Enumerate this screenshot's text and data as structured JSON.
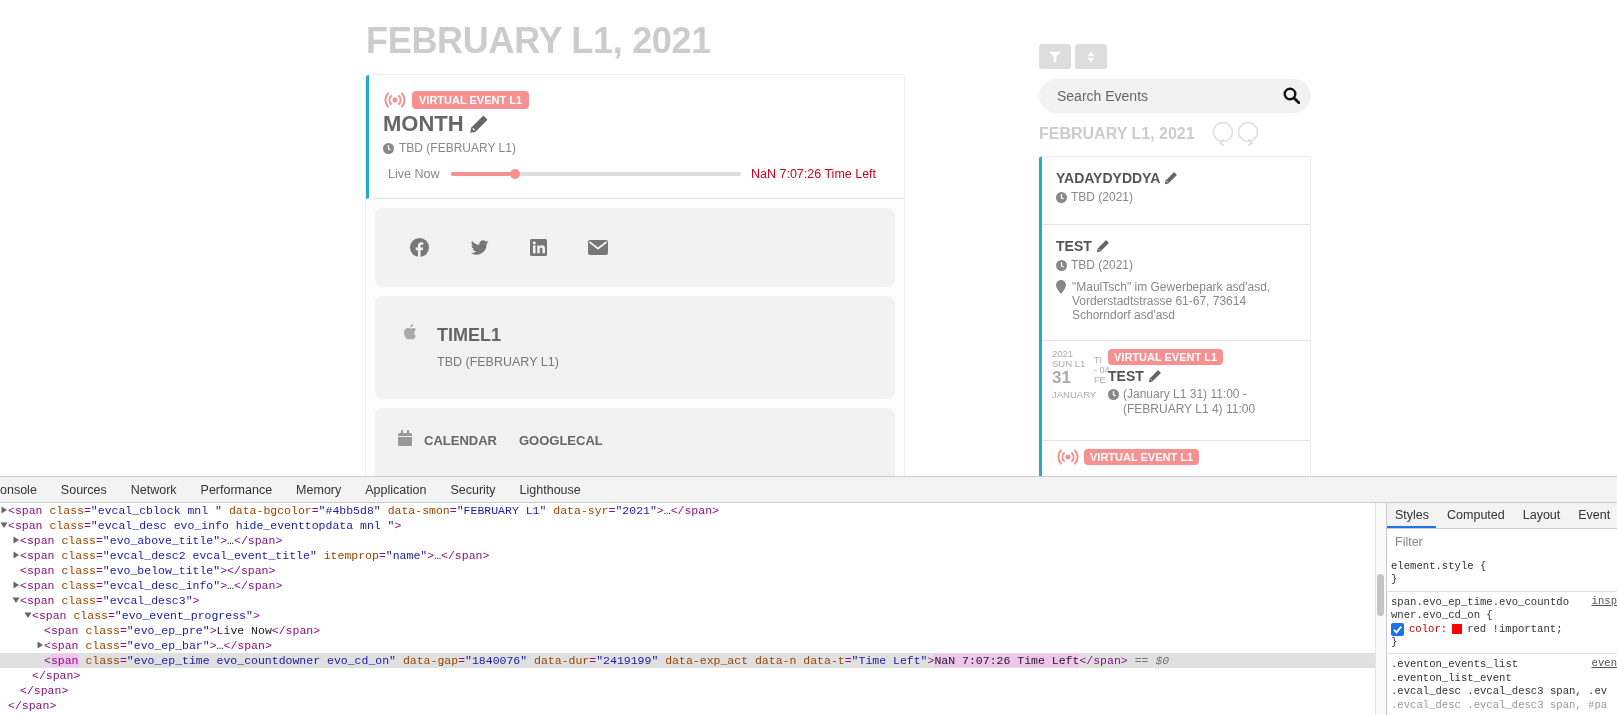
{
  "main": {
    "title": "FEBRUARY L1, 2021",
    "event": {
      "badge": "VIRTUAL EVENT L1",
      "title": "MONTH",
      "time": "TBD (FEBRUARY L1)",
      "progress": {
        "label": "Live Now",
        "level": 0.22,
        "reading": "NaN 7:07:26 Time Left"
      }
    },
    "share": [
      {
        "kind": "facebook"
      },
      {
        "kind": "twitter"
      },
      {
        "kind": "linkedin"
      },
      {
        "kind": "email"
      }
    ],
    "details": {
      "title": "TIMEL1",
      "time": "TBD (FEBRUARY L1)"
    },
    "add_to_calendar": [
      "CALENDAR",
      "GOOGLECAL"
    ]
  },
  "sidebar": {
    "search": {
      "placeholder": "Search Events"
    },
    "month_title": "FEBRUARY L1, 2021",
    "events": [
      {
        "kind": "plain",
        "title": "YADAYDYDDYA",
        "time": "TBD (2021)"
      },
      {
        "kind": "plain",
        "title": "TEST",
        "time": "TBD (2021)",
        "location": "\"MaulTsch\" im Gewerbepark asd'asd, Vorderstadtstrasse 61-67, 73614 Schorndorf asd'asd"
      },
      {
        "kind": "dated",
        "date": {
          "year": "2021",
          "weekday": "SUN L1",
          "day": "31",
          "month": "JANUARY",
          "end_fragments": [
            "TI",
            "- 04",
            "FE"
          ]
        },
        "badge": "VIRTUAL EVENT L1",
        "title": "TEST",
        "time": "(January L1 31) 11:00 - (FEBRUARY L1 4) 11:00"
      },
      {
        "kind": "live",
        "badge": "VIRTUAL EVENT L1"
      }
    ]
  },
  "devtools": {
    "tabs": [
      {
        "label": "onsole",
        "selected": false
      },
      {
        "label": "Sources",
        "selected": false
      },
      {
        "label": "Network",
        "selected": false
      },
      {
        "label": "Performance",
        "selected": false
      },
      {
        "label": "Memory",
        "selected": false
      },
      {
        "label": "Application",
        "selected": false
      },
      {
        "label": "Security",
        "selected": false
      },
      {
        "label": "Lighthouse",
        "selected": false
      }
    ],
    "dom": [
      {
        "expanded": false,
        "selected": false,
        "markup": "<span class=\"evcal_cblock mnl \" data-bgcolor=\"#4bb5d8\" data-smon=\"FEBRUARY L1\" data-syr=\"2021\">…</span>"
      },
      {
        "expanded": true,
        "selected": false,
        "markup": "<span class=\"evcal_desc evo_info hide_eventtopdata mnl \">",
        "close": "</span>",
        "children": [
          {
            "expanded": false,
            "selected": false,
            "markup": "<span class=\"evo_above_title\">…</span>"
          },
          {
            "expanded": false,
            "selected": false,
            "markup": "<span class=\"evcal_desc2 evcal_event_title\" itemprop=\"name\">…</span>"
          },
          {
            "selected": false,
            "markup": "<span class=\"evo_below_title\"></span>"
          },
          {
            "expanded": false,
            "selected": false,
            "markup": "<span class=\"evcal_desc_info\">…</span>"
          },
          {
            "expanded": true,
            "selected": false,
            "markup": "<span class=\"evcal_desc3\">",
            "close": "</span>",
            "children": [
              {
                "expanded": true,
                "selected": false,
                "markup": "<span class=\"evo_event_progress\">",
                "close": "</span>",
                "children": [
                  {
                    "selected": false,
                    "markup": "<span class=\"evo_ep_pre\">Live Now</span>"
                  },
                  {
                    "expanded": false,
                    "selected": false,
                    "markup": "<span class=\"evo_ep_bar\">…</span>"
                  },
                  {
                    "selected": true,
                    "markup": "<span class=\"evo_ep_time evo_countdowner evo_cd_on\" data-gap=\"1840076\" data-dur=\"2419199\" data-exp_act data-n data-t=\"Time Left\">NaN 7:07:26 Time Left</span>",
                    "suffix": "== $0"
                  }
                ]
              }
            ]
          }
        ]
      }
    ],
    "styles": {
      "tabs": [
        {
          "label": "Styles",
          "selected": true
        },
        {
          "label": "Computed",
          "selected": false
        },
        {
          "label": "Layout",
          "selected": false
        },
        {
          "label": "Event",
          "selected": false
        }
      ],
      "filter": {
        "placeholder": "Filter"
      },
      "rules": [
        {
          "selector": [
            "element.style {"
          ],
          "close": "}"
        },
        {
          "selector": [
            "span.evo_ep_time.evo_countdo",
            "wner.evo_cd_on {"
          ],
          "source": "insp",
          "declarations": [
            {
              "checked": true,
              "property": "color:",
              "color": "#ff0000",
              "value": "red !important;"
            }
          ],
          "close": "}"
        },
        {
          "selector": [
            ".eventon_events_list",
            ".eventon_list_event",
            ".evcal_desc .evcal_desc3 span, .ev"
          ],
          "source": "even",
          "dimmed": [
            ".evcal_desc .evcal_desc3 span, #pa"
          ]
        }
      ]
    }
  }
}
